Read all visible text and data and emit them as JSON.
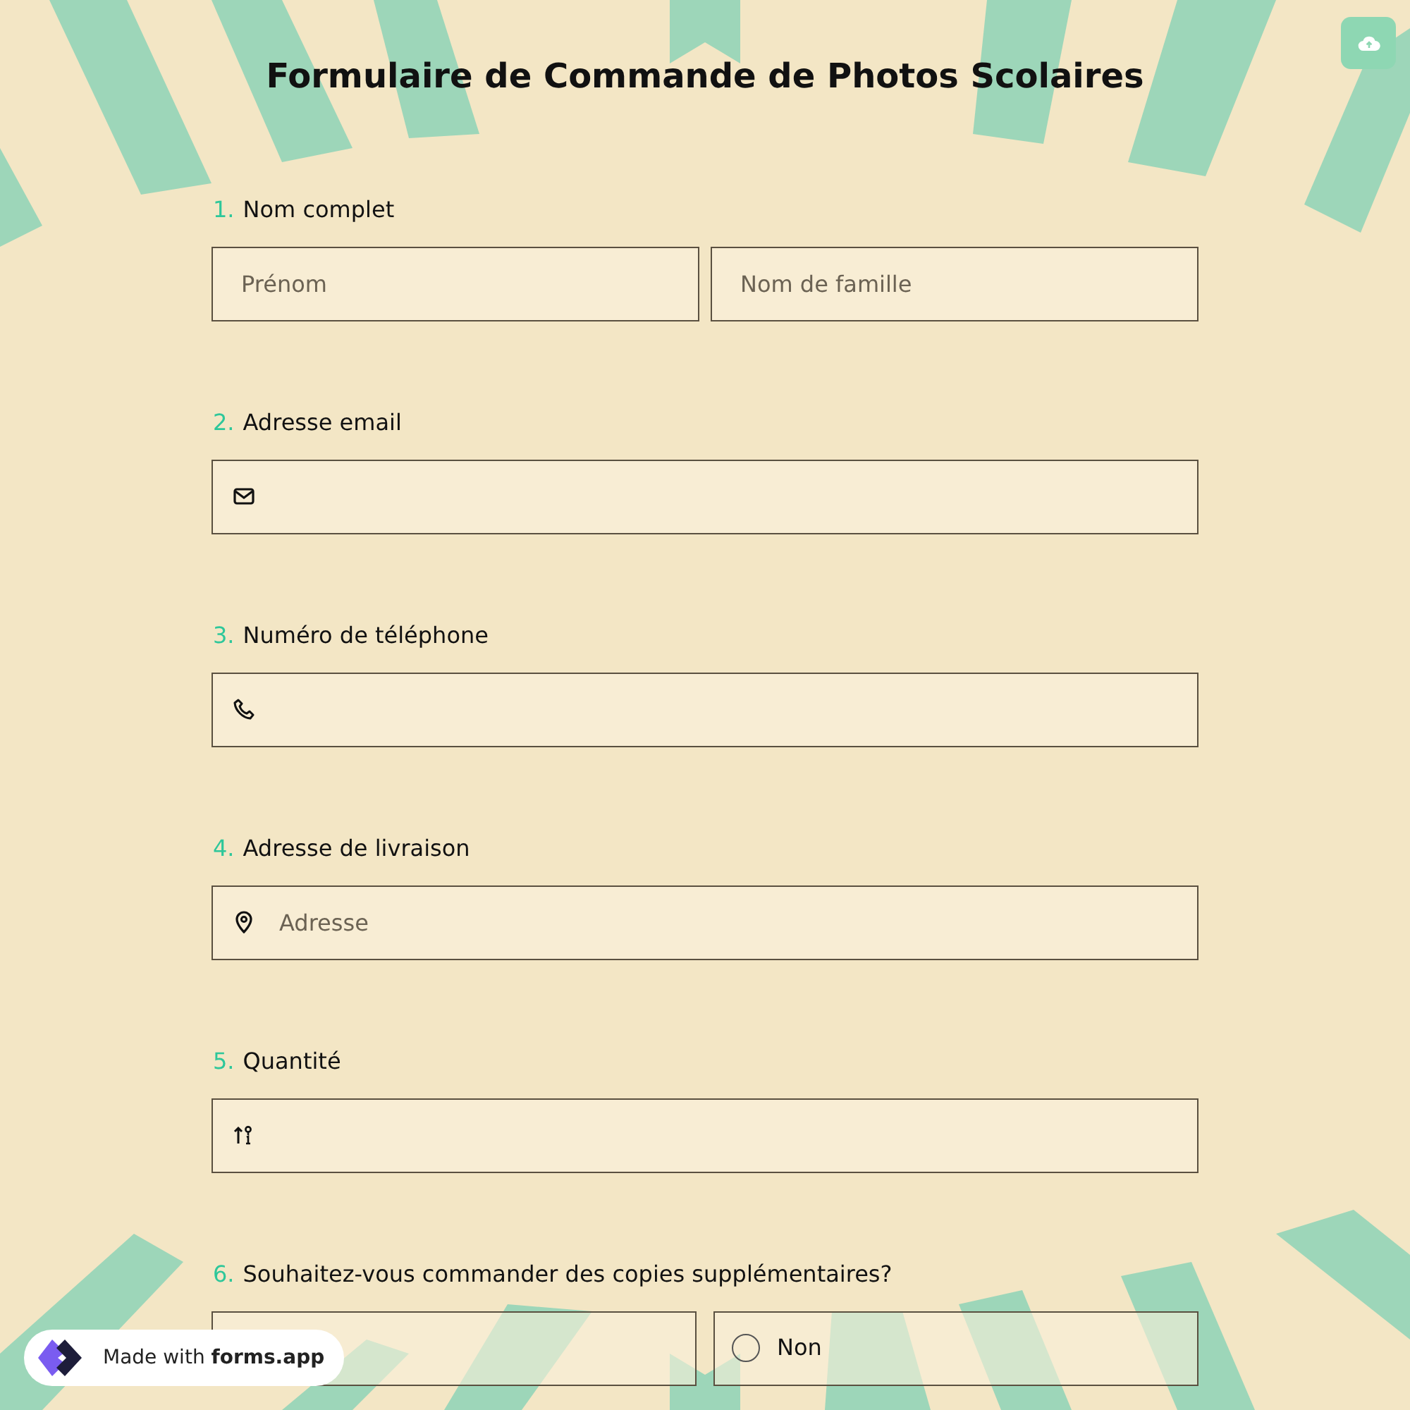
{
  "title": "Formulaire de Commande de Photos Scolaires",
  "questions": [
    {
      "number": "1.",
      "label": "Nom complet",
      "kind": "name",
      "fields": [
        {
          "placeholder": "Prénom"
        },
        {
          "placeholder": "Nom de famille"
        }
      ]
    },
    {
      "number": "2.",
      "label": "Adresse email",
      "kind": "email"
    },
    {
      "number": "3.",
      "label": "Numéro de téléphone",
      "kind": "phone"
    },
    {
      "number": "4.",
      "label": "Adresse de livraison",
      "kind": "address",
      "placeholder": "Adresse"
    },
    {
      "number": "5.",
      "label": "Quantité",
      "kind": "number"
    },
    {
      "number": "6.",
      "label": "Souhaitez-vous commander des copies supplémentaires?",
      "kind": "choice",
      "options": [
        {
          "kind": "covered"
        },
        {
          "kind": "radio",
          "label": "Non",
          "selected": false
        }
      ]
    }
  ],
  "badge": {
    "text": "Made with **forms.app**"
  }
}
